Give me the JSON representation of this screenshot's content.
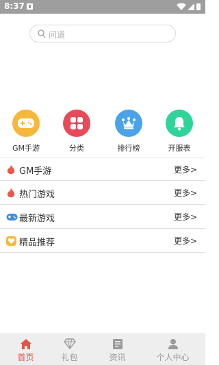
{
  "statusbar": {
    "time": "8:37"
  },
  "search": {
    "placeholder": "问道"
  },
  "categories": [
    {
      "label": "GM手游",
      "color": "#f5b83c",
      "icon": "gamepad-icon"
    },
    {
      "label": "分类",
      "color": "#e84a5a",
      "icon": "grid-icon"
    },
    {
      "label": "排行榜",
      "color": "#4aa3e8",
      "icon": "crown-icon"
    },
    {
      "label": "开服表",
      "color": "#2fd49a",
      "icon": "bell-icon"
    }
  ],
  "sections": [
    {
      "title": "GM手游",
      "more": "更多>",
      "icon": "flame-icon"
    },
    {
      "title": "热门游戏",
      "more": "更多>",
      "icon": "flame-icon"
    },
    {
      "title": "最新游戏",
      "more": "更多>",
      "icon": "controller-icon"
    },
    {
      "title": "精品推荐",
      "more": "更多>",
      "icon": "heart-icon"
    }
  ],
  "tabs": [
    {
      "label": "首页",
      "icon": "home-icon",
      "active": true
    },
    {
      "label": "礼包",
      "icon": "diamond-icon",
      "active": false
    },
    {
      "label": "资讯",
      "icon": "news-icon",
      "active": false
    },
    {
      "label": "个人中心",
      "icon": "person-icon",
      "active": false
    }
  ],
  "colors": {
    "accent": "#e25348",
    "tab_inactive": "#9a9a9a"
  }
}
